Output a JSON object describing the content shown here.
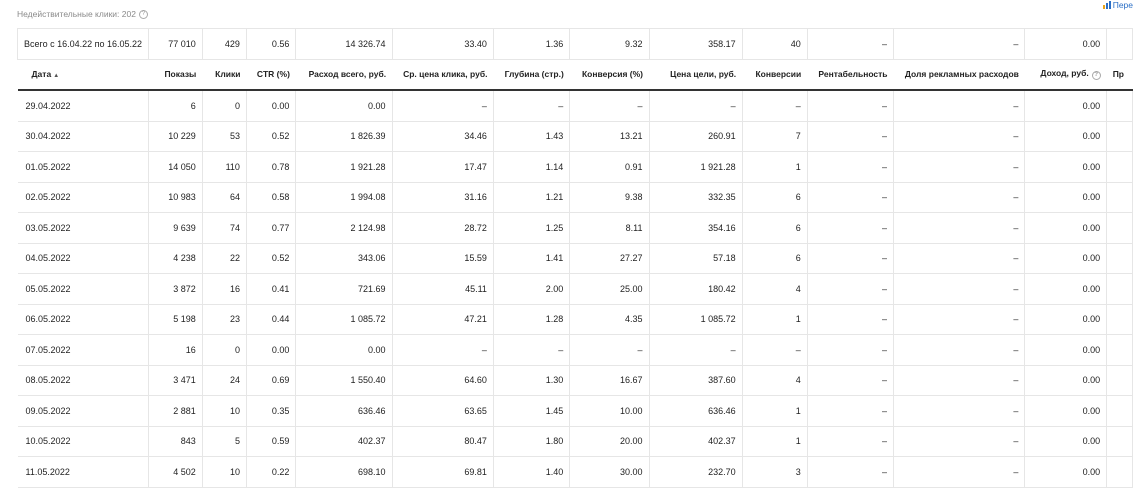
{
  "invalid_clicks": "Недействительные клики: 202",
  "top_link": "Пере",
  "columns": [
    "Дата",
    "Показы",
    "Клики",
    "CTR (%)",
    "Расход всего, руб.",
    "Ср. цена клика, руб.",
    "Глубина (стр.)",
    "Конверсия (%)",
    "Цена цели, руб.",
    "Конверсии",
    "Рентабельность",
    "Доля рекламных расходов",
    "Доход, руб.",
    "Пр"
  ],
  "total": [
    "Всего с 16.04.22 по 16.05.22",
    "77 010",
    "429",
    "0.56",
    "14 326.74",
    "33.40",
    "1.36",
    "9.32",
    "358.17",
    "40",
    "–",
    "–",
    "0.00",
    ""
  ],
  "rows": [
    [
      "29.04.2022",
      "6",
      "0",
      "0.00",
      "0.00",
      "–",
      "–",
      "–",
      "–",
      "–",
      "–",
      "–",
      "0.00",
      ""
    ],
    [
      "30.04.2022",
      "10 229",
      "53",
      "0.52",
      "1 826.39",
      "34.46",
      "1.43",
      "13.21",
      "260.91",
      "7",
      "–",
      "–",
      "0.00",
      ""
    ],
    [
      "01.05.2022",
      "14 050",
      "110",
      "0.78",
      "1 921.28",
      "17.47",
      "1.14",
      "0.91",
      "1 921.28",
      "1",
      "–",
      "–",
      "0.00",
      ""
    ],
    [
      "02.05.2022",
      "10 983",
      "64",
      "0.58",
      "1 994.08",
      "31.16",
      "1.21",
      "9.38",
      "332.35",
      "6",
      "–",
      "–",
      "0.00",
      ""
    ],
    [
      "03.05.2022",
      "9 639",
      "74",
      "0.77",
      "2 124.98",
      "28.72",
      "1.25",
      "8.11",
      "354.16",
      "6",
      "–",
      "–",
      "0.00",
      ""
    ],
    [
      "04.05.2022",
      "4 238",
      "22",
      "0.52",
      "343.06",
      "15.59",
      "1.41",
      "27.27",
      "57.18",
      "6",
      "–",
      "–",
      "0.00",
      ""
    ],
    [
      "05.05.2022",
      "3 872",
      "16",
      "0.41",
      "721.69",
      "45.11",
      "2.00",
      "25.00",
      "180.42",
      "4",
      "–",
      "–",
      "0.00",
      ""
    ],
    [
      "06.05.2022",
      "5 198",
      "23",
      "0.44",
      "1 085.72",
      "47.21",
      "1.28",
      "4.35",
      "1 085.72",
      "1",
      "–",
      "–",
      "0.00",
      ""
    ],
    [
      "07.05.2022",
      "16",
      "0",
      "0.00",
      "0.00",
      "–",
      "–",
      "–",
      "–",
      "–",
      "–",
      "–",
      "0.00",
      ""
    ],
    [
      "08.05.2022",
      "3 471",
      "24",
      "0.69",
      "1 550.40",
      "64.60",
      "1.30",
      "16.67",
      "387.60",
      "4",
      "–",
      "–",
      "0.00",
      ""
    ],
    [
      "09.05.2022",
      "2 881",
      "10",
      "0.35",
      "636.46",
      "63.65",
      "1.45",
      "10.00",
      "636.46",
      "1",
      "–",
      "–",
      "0.00",
      ""
    ],
    [
      "10.05.2022",
      "843",
      "5",
      "0.59",
      "402.37",
      "80.47",
      "1.80",
      "20.00",
      "402.37",
      "1",
      "–",
      "–",
      "0.00",
      ""
    ],
    [
      "11.05.2022",
      "4 502",
      "10",
      "0.22",
      "698.10",
      "69.81",
      "1.40",
      "30.00",
      "232.70",
      "3",
      "–",
      "–",
      "0.00",
      ""
    ]
  ],
  "colors": {
    "link": "#2b6fc6",
    "muted": "#8a8a8a",
    "grid": "#e6e6e6",
    "bars": [
      "#e8a317",
      "#2b6fc6",
      "#2b6fc6"
    ]
  }
}
